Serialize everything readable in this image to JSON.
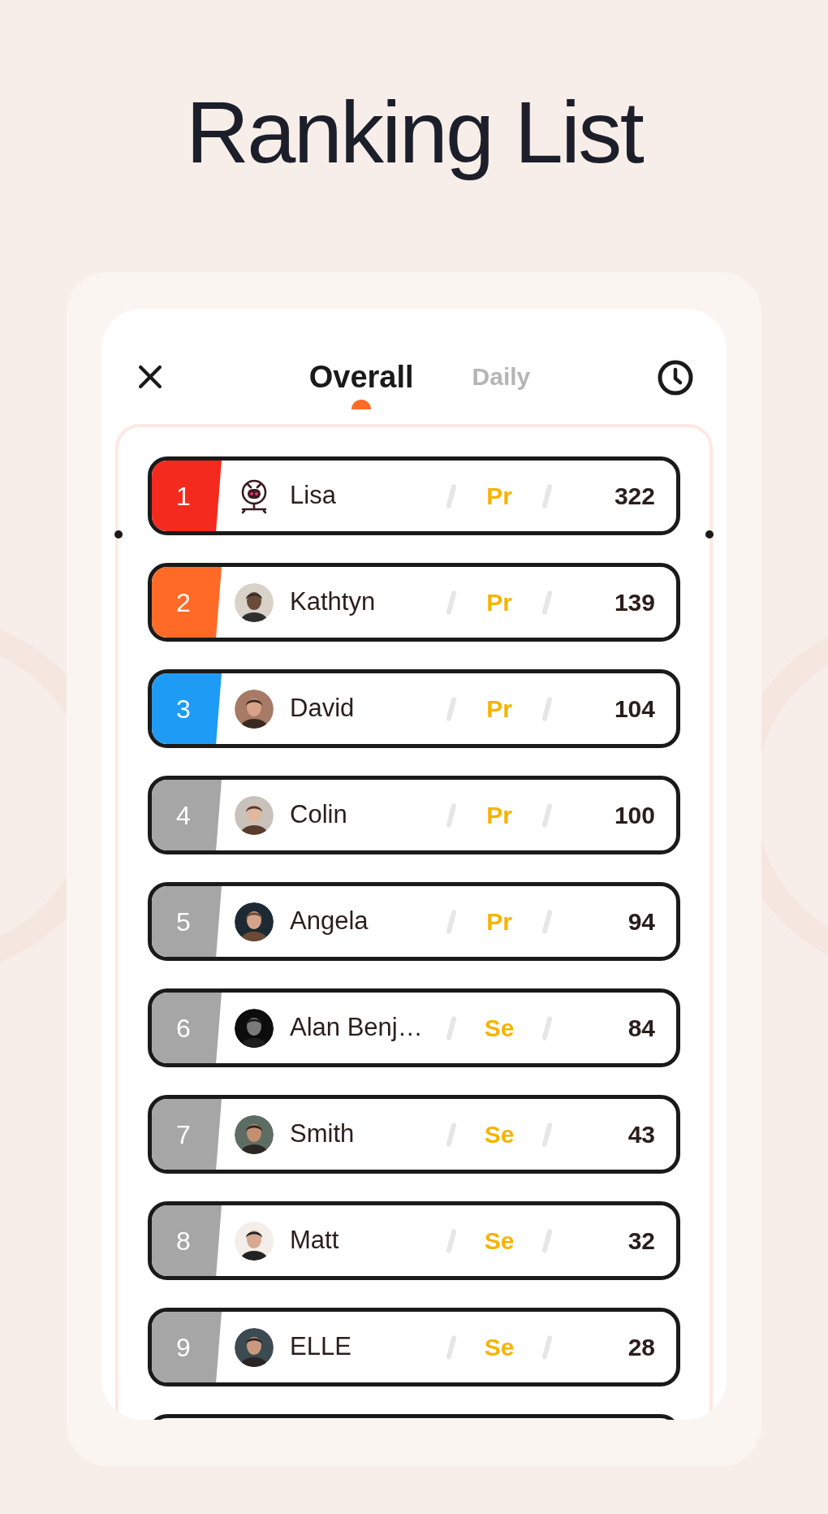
{
  "title": "Ranking List",
  "tabs": [
    {
      "label": "Overall",
      "selected": true
    },
    {
      "label": "Daily",
      "selected": false
    }
  ],
  "rows": [
    {
      "rank": "1",
      "color": "#f52a1e",
      "avatar": {
        "kind": "icon"
      },
      "name": "Lisa",
      "level": "Pr",
      "score": "322"
    },
    {
      "rank": "2",
      "color": "#ff6a26",
      "name": "Kathtyn",
      "level": "Pr",
      "score": "139"
    },
    {
      "rank": "3",
      "color": "#1e9bf5",
      "name": "David",
      "level": "Pr",
      "score": "104"
    },
    {
      "rank": "4",
      "color": "#a6a6a6",
      "name": "Colin",
      "level": "Pr",
      "score": "100"
    },
    {
      "rank": "5",
      "color": "#a6a6a6",
      "name": "Angela",
      "level": "Pr",
      "score": "94"
    },
    {
      "rank": "6",
      "color": "#a6a6a6",
      "name": "Alan Benj…",
      "level": "Se",
      "score": "84"
    },
    {
      "rank": "7",
      "color": "#a6a6a6",
      "name": "Smith",
      "level": "Se",
      "score": "43"
    },
    {
      "rank": "8",
      "color": "#a6a6a6",
      "name": "Matt",
      "level": "Se",
      "score": "32"
    },
    {
      "rank": "9",
      "color": "#a6a6a6",
      "name": "ELLE",
      "level": "Se",
      "score": "28"
    }
  ]
}
